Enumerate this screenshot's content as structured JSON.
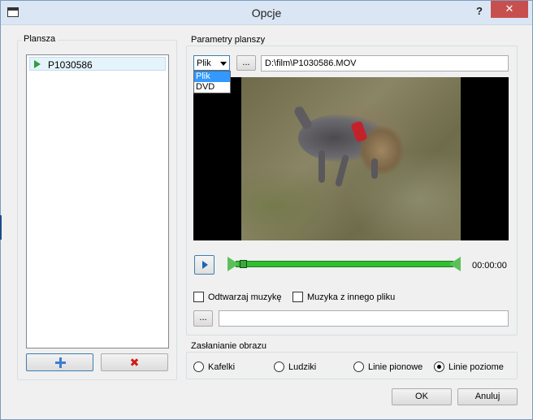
{
  "window": {
    "title": "Opcje",
    "help": "?",
    "close": "✕"
  },
  "board_group": {
    "title": "Plansza",
    "items": [
      {
        "label": "P1030586"
      }
    ],
    "add_icon": "plus-icon",
    "remove_icon": "x-icon"
  },
  "params_group": {
    "title": "Parametry planszy",
    "source_combo": {
      "value": "Plik",
      "options": [
        "Plik",
        "DVD"
      ]
    },
    "browse_label": "...",
    "file_path": "D:\\film\\P1030586.MOV",
    "time": "00:00:00",
    "play_music_label": "Odtwarzaj muzykę",
    "music_from_other_file_label": "Muzyka z innego pliku",
    "music_browse_label": "...",
    "music_path": ""
  },
  "cover_group": {
    "title": "Zasłanianie obrazu",
    "options": [
      {
        "label": "Kafelki",
        "checked": false
      },
      {
        "label": "Ludziki",
        "checked": false
      },
      {
        "label": "Linie pionowe",
        "checked": false
      },
      {
        "label": "Linie poziome",
        "checked": true
      }
    ]
  },
  "footer": {
    "ok": "OK",
    "cancel": "Anuluj"
  },
  "colors": {
    "accent_blue": "#3c7fb1",
    "timeline_green": "#2fbf2f",
    "close_red": "#c7504f"
  }
}
